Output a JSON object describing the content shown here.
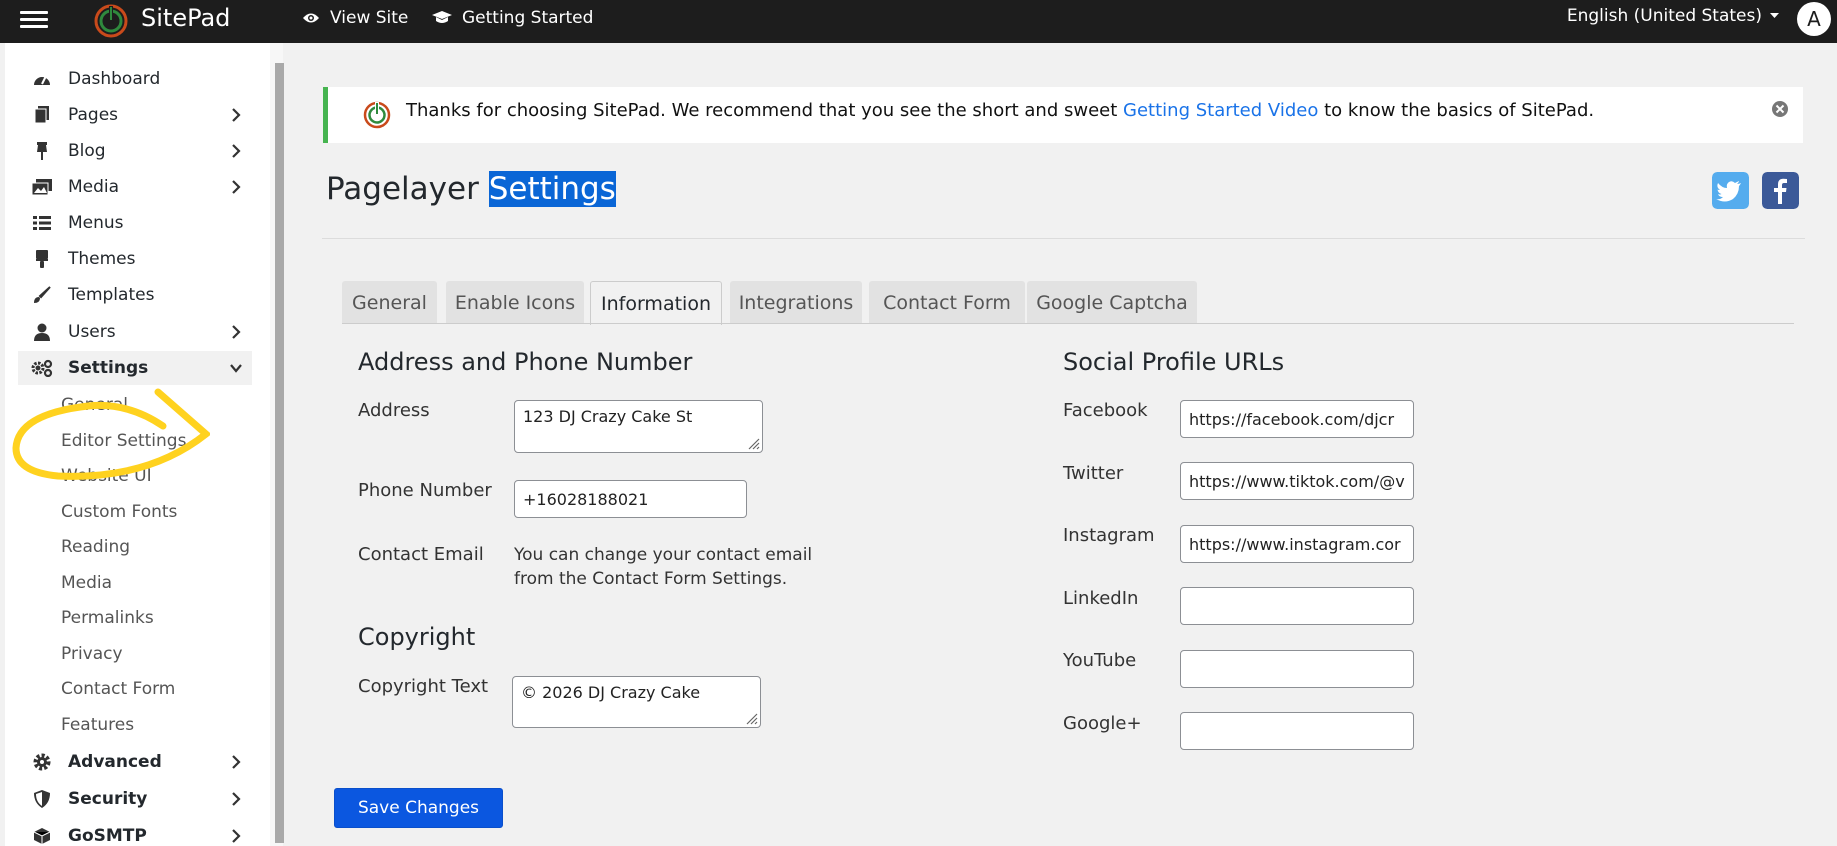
{
  "topbar": {
    "brand": "SitePad",
    "view_site": "View Site",
    "getting_started": "Getting Started",
    "language": "English (United States)",
    "avatar_letter": "A"
  },
  "sidebar": {
    "items": [
      {
        "label": "Dashboard",
        "icon": "dashboard-icon",
        "has_arrow": false
      },
      {
        "label": "Pages",
        "icon": "pages-icon",
        "has_arrow": true
      },
      {
        "label": "Blog",
        "icon": "pin-icon",
        "has_arrow": true
      },
      {
        "label": "Media",
        "icon": "media-icon",
        "has_arrow": true
      },
      {
        "label": "Menus",
        "icon": "menus-icon",
        "has_arrow": false
      },
      {
        "label": "Themes",
        "icon": "themes-icon",
        "has_arrow": false
      },
      {
        "label": "Templates",
        "icon": "brush-icon",
        "has_arrow": false
      },
      {
        "label": "Users",
        "icon": "user-icon",
        "has_arrow": true
      },
      {
        "label": "Settings",
        "icon": "settings-icon",
        "has_arrow": true,
        "expanded": true
      }
    ],
    "settings_sub": [
      "General",
      "Editor Settings",
      "Website UI",
      "Custom Fonts",
      "Reading",
      "Media",
      "Permalinks",
      "Privacy",
      "Contact Form",
      "Features"
    ],
    "bottom_items": [
      {
        "label": "Advanced",
        "icon": "gear-icon"
      },
      {
        "label": "Security",
        "icon": "shield-icon"
      },
      {
        "label": "GoSMTP",
        "icon": "box-icon"
      }
    ]
  },
  "notice": {
    "text_before": "Thanks for choosing SitePad. We recommend that you see the short and sweet ",
    "link": "Getting Started Video",
    "text_after": " to know the basics of SitePad."
  },
  "page": {
    "title_plain": "Pagelayer ",
    "title_selected": "Settings"
  },
  "tabs": [
    "General",
    "Enable Icons",
    "Information",
    "Integrations",
    "Contact Form",
    "Google Captcha"
  ],
  "active_tab": "Information",
  "address_section": {
    "title": "Address and Phone Number",
    "address_label": "Address",
    "address_value": "123 DJ Crazy Cake St",
    "phone_label": "Phone Number",
    "phone_value": "+16028188021",
    "email_label": "Contact Email",
    "email_note": "You can change your contact email from the Contact Form Settings."
  },
  "copyright_section": {
    "title": "Copyright",
    "label": "Copyright Text",
    "value": "© 2026 DJ Crazy Cake"
  },
  "social_section": {
    "title": "Social Profile URLs",
    "fields": [
      {
        "label": "Facebook",
        "value": "https://facebook.com/djcr"
      },
      {
        "label": "Twitter",
        "value": "https://www.tiktok.com/@v"
      },
      {
        "label": "Instagram",
        "value": "https://www.instagram.cor"
      },
      {
        "label": "LinkedIn",
        "value": ""
      },
      {
        "label": "YouTube",
        "value": ""
      },
      {
        "label": "Google+",
        "value": ""
      }
    ]
  },
  "save_button": "Save Changes",
  "colors": {
    "topbar": "#1d1d1d",
    "notice_border": "#46b450",
    "link": "#1a73e8",
    "save_button": "#0b57e0",
    "twitter": "#55acee",
    "facebook": "#3b5998",
    "scribble": "#ffd21f"
  }
}
